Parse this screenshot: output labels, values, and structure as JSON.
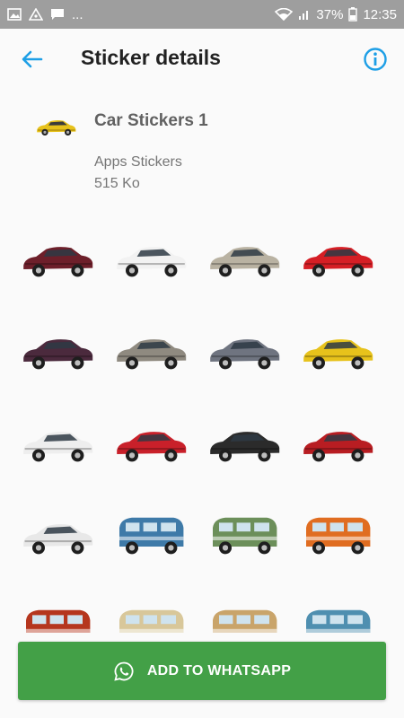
{
  "status_bar": {
    "notifications": "...",
    "battery": "37%",
    "time": "12:35"
  },
  "toolbar": {
    "title": "Sticker details",
    "back_icon": "arrow-left-icon",
    "info_icon": "info-icon"
  },
  "pack": {
    "name": "Car Stickers 1",
    "publisher": "Apps Stickers",
    "size": "515 Ko"
  },
  "stickers": [
    {
      "name": "suv-maroon",
      "color": "#6d1f2a"
    },
    {
      "name": "sedan-white",
      "color": "#f2f2f2"
    },
    {
      "name": "classic-silver",
      "color": "#b9b2a2"
    },
    {
      "name": "coupe-red",
      "color": "#d51e25"
    },
    {
      "name": "sedan-purple",
      "color": "#4b2a3d"
    },
    {
      "name": "vintage-silver",
      "color": "#8f8a80"
    },
    {
      "name": "supercar-grey",
      "color": "#6f7480"
    },
    {
      "name": "muscle-yellow",
      "color": "#e7c21b"
    },
    {
      "name": "suv-white",
      "color": "#eeeeee"
    },
    {
      "name": "sports-red",
      "color": "#c9202a"
    },
    {
      "name": "hypercar-black",
      "color": "#2b2b2b"
    },
    {
      "name": "muscle-red",
      "color": "#b81d22"
    },
    {
      "name": "jeep-white",
      "color": "#e8e8e8"
    },
    {
      "name": "van-blue",
      "color": "#3e7aa8"
    },
    {
      "name": "van-painted",
      "color": "#6c8f5a"
    },
    {
      "name": "van-orange",
      "color": "#e06d21"
    },
    {
      "name": "van-red",
      "color": "#b5361e"
    },
    {
      "name": "van-cream",
      "color": "#d8c79a"
    },
    {
      "name": "van-beige",
      "color": "#c9a46a"
    },
    {
      "name": "van-teal",
      "color": "#4f8fb0"
    }
  ],
  "add_button": {
    "label": "ADD TO WHATSAPP",
    "color": "#43a047"
  }
}
